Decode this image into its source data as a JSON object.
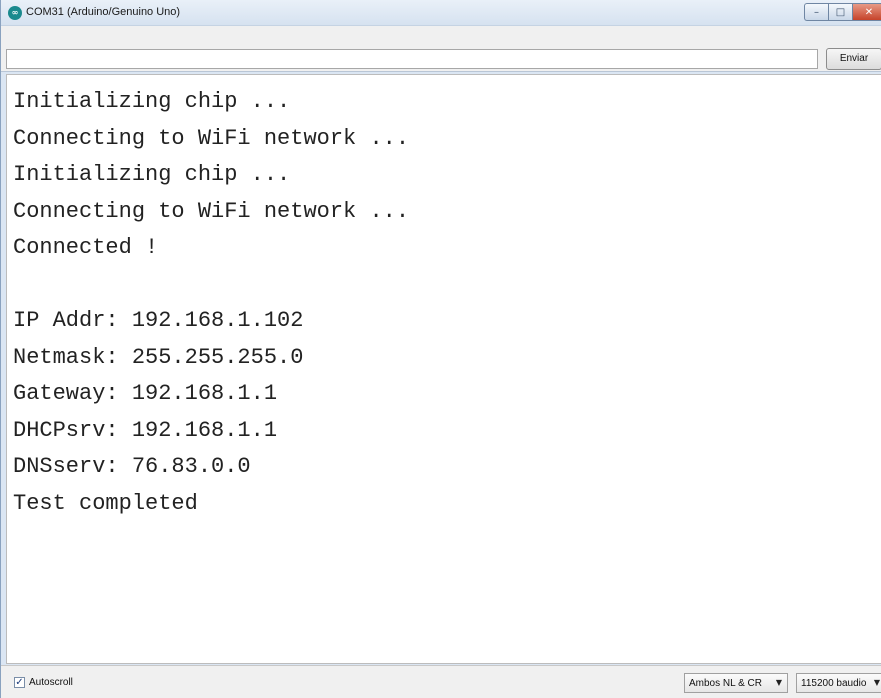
{
  "window": {
    "title": "COM31 (Arduino/Genuino Uno)",
    "icon": "arduino-logo-icon",
    "controls": {
      "minimize": "minimize-icon",
      "maximize": "maximize-icon",
      "close": "close-icon"
    }
  },
  "send": {
    "input_value": "",
    "button_label": "Enviar"
  },
  "output": {
    "lines": [
      "Initializing chip ...",
      "Connecting to WiFi network ...",
      "Initializing chip ...",
      "Connecting to WiFi network ...",
      "Connected !",
      "",
      "IP Addr: 192.168.1.102",
      "Netmask: 255.255.255.0",
      "Gateway: 192.168.1.1",
      "DHCPsrv: 192.168.1.1",
      "DNSserv: 76.83.0.0",
      "Test completed"
    ]
  },
  "footer": {
    "autoscroll_label": "Autoscroll",
    "autoscroll_checked": true,
    "line_ending": "Ambos NL & CR",
    "baud_rate": "115200 baudio"
  }
}
